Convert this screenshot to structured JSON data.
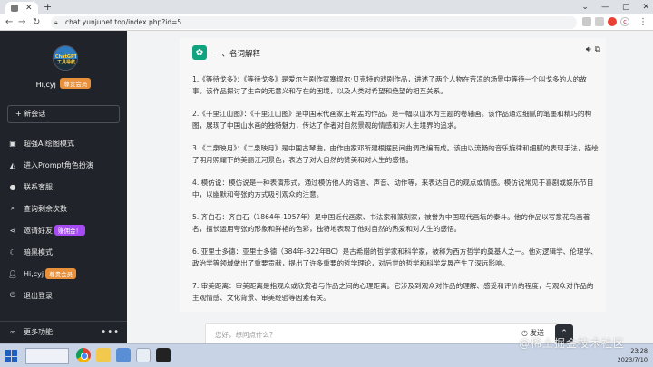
{
  "browser": {
    "url": "chat.yunjunet.top/index.php?id=5",
    "profile_initial": "c"
  },
  "sidebar": {
    "avatar_text": "ChatGPT\n工具导航",
    "user_name": "Hi,cyj",
    "user_badge": "尊贵会员",
    "new_chat_label": "+ 新会话",
    "items": [
      {
        "icon": "image-icon",
        "label": "超强AI绘图模式"
      },
      {
        "icon": "graduation-cap-icon",
        "label": "进入Prompt角色扮演"
      },
      {
        "icon": "chat-bubbles-icon",
        "label": "联系客服"
      },
      {
        "icon": "search-icon",
        "label": "查询剩余次数"
      },
      {
        "icon": "share-icon",
        "label": "邀请好友",
        "badge": "赚佣金！"
      },
      {
        "icon": "moon-icon",
        "label": "暗黑模式"
      },
      {
        "icon": "user-icon",
        "label": "Hi,cyj",
        "badge": "尊贵会员"
      },
      {
        "icon": "power-icon",
        "label": "退出登录"
      }
    ],
    "more_label": "更多功能"
  },
  "message": {
    "title": "一、名词解释",
    "paragraphs": [
      "1.《等待戈多》：《等待戈多》是爱尔兰剧作家塞缪尔·贝克特的戏剧作品，讲述了两个人物在荒凉的场景中等待一个叫戈多的人的故事。该作品探讨了生命的无意义和存在的困境，以及人类对希望和绝望的相互关系。",
      "2.《千里江山图》：《千里江山图》是中国宋代画家王希孟的作品，是一幅以山水为主题的卷轴画。该作品通过细腻的笔墨和精巧的构图，展现了中国山水画的独特魅力，传达了作者对自然景观的情感和对人生境界的追求。",
      "3.《二泉映月》：《二泉映月》是中国古琴曲，由作曲家邓所建根据民间曲调改编而成。该曲以流畅的音乐旋律和细腻的表现手法，描绘了明月照耀下的美丽江河景色，表达了对大自然的赞美和对人生的感悟。",
      "4. 模仿说：模仿说是一种表演形式，通过模仿他人的语言、声音、动作等，来表达自己的观点或情感。模仿说常见于喜剧或娱乐节目中，以幽默和夸张的方式吸引观众的注意。",
      "5. 齐白石：齐白石（1864年-1957年）是中国近代画家、书法家和篆刻家，被誉为中国现代画坛的泰斗。他的作品以写意花鸟画著名，擅长运用夸张的形象和鲜艳的色彩，独特地表现了他对自然的热爱和对人生的感悟。",
      "6. 亚里士多德：亚里士多德（384年-322年BC）是古希腊的哲学家和科学家，被称为西方哲学的奠基人之一。他对逻辑学、伦理学、政治学等领域做出了重要贡献，提出了许多重要的哲学理论，对后世的哲学和科学发展产生了深远影响。",
      "7. 审美距离：审美距离是指观众或欣赏者与作品之间的心理距离。它涉及到观众对作品的理解、感受和评价的程度，与观众对作品的主观情感、文化背景、审美经验等因素有关。"
    ]
  },
  "composer": {
    "placeholder": "您好，想问点什么？",
    "send_label": "发送"
  },
  "taskbar": {
    "time": "23:28",
    "date": "2023/7/10"
  },
  "watermark": "@稀土掘金技术社区"
}
